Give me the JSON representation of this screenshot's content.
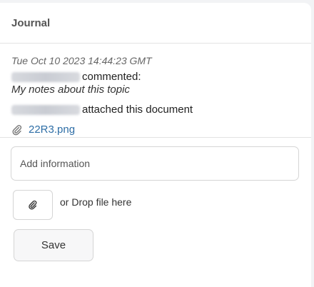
{
  "journal": {
    "title": "Journal",
    "entry": {
      "timestamp": "Tue Oct 10 2023 14:44:23 GMT",
      "comment_action": "commented:",
      "comment_text": "My notes about this topic",
      "attach_action": "attached this document",
      "attachment_name": "22R3.png"
    }
  },
  "form": {
    "info_placeholder": "Add information",
    "drop_text": "or Drop file here",
    "save_label": "Save"
  }
}
